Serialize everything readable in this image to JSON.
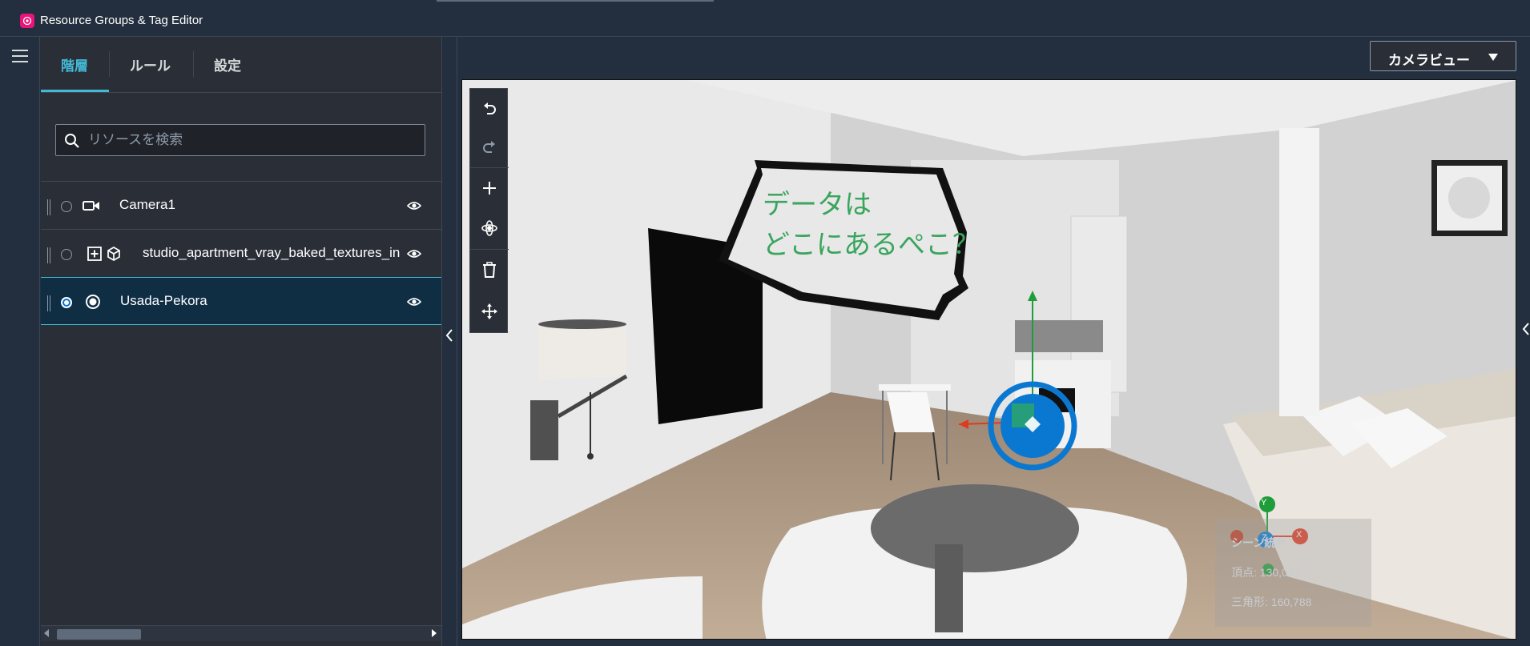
{
  "app": {
    "title": "Resource Groups & Tag Editor"
  },
  "tabs": [
    {
      "label": "階層"
    },
    {
      "label": "ルール"
    },
    {
      "label": "設定"
    }
  ],
  "search": {
    "placeholder": "リソースを検索",
    "value": ""
  },
  "tree": [
    {
      "label": "Camera1",
      "icon": "camera-icon",
      "selected": false
    },
    {
      "label": "studio_apartment_vray_baked_textures_in",
      "icon": "cube-icon",
      "selected": false
    },
    {
      "label": "Usada-Pekora",
      "icon": "target-icon",
      "selected": true
    }
  ],
  "viewer": {
    "camera_view_label": "カメラビュー",
    "bubble_line1": "データは",
    "bubble_line2": "どこにあるぺこ？",
    "stats": {
      "title": "シーン統計",
      "vertices": "頂点: 130,097",
      "triangles": "三角形: 160,788"
    },
    "axes": {
      "y": "Y",
      "z": "Z",
      "x": "X"
    }
  },
  "colors": {
    "accent": "#44b9d6",
    "brand": "#e7157b",
    "gizmo_blue": "#0a78d1",
    "bubble_text": "#3aa55d"
  }
}
